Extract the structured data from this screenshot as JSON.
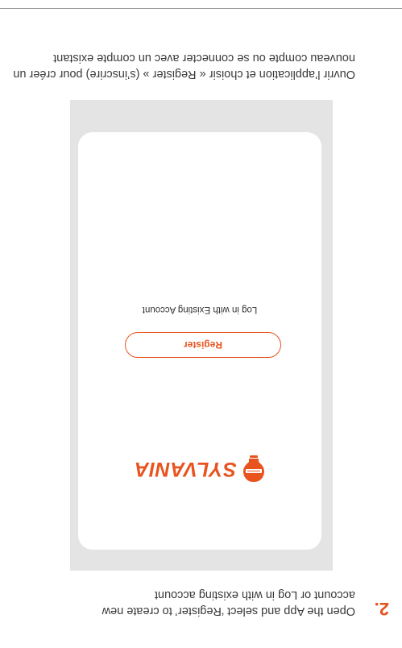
{
  "step": {
    "number": "2.",
    "instruction_en": "Open the App and select ‘Register’ to create new account or Log in with existing account",
    "instruction_fr": "Ouvrir l’application et choisir « Register » (s’inscrire) pour créer un nouveau compte ou se connecter avec un compte existant"
  },
  "app_screen": {
    "logo_text": "SYLVANIA",
    "register_label": "Register",
    "login_label": "Log in with Existing Account"
  },
  "colors": {
    "accent": "#e8531e",
    "panel": "#e4e4e4",
    "text": "#3a3a3a"
  },
  "icons": {
    "logo": "sylvania-bulb-icon"
  }
}
